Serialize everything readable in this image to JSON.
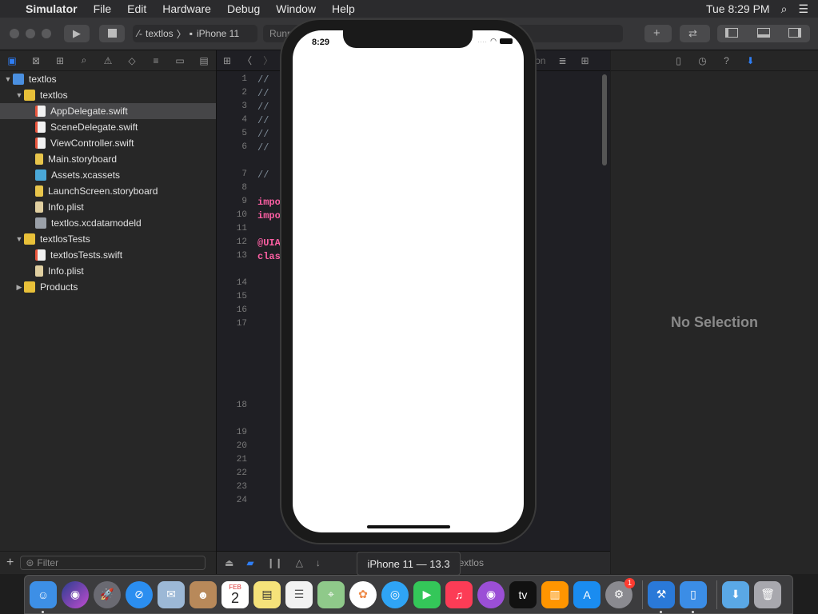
{
  "menubar": {
    "app": "Simulator",
    "menus": [
      "File",
      "Edit",
      "Hardware",
      "Debug",
      "Window",
      "Help"
    ],
    "clock": "Tue 8:29 PM"
  },
  "toolbar": {
    "scheme": "textlos",
    "device": "iPhone 11",
    "status": "Running"
  },
  "navigator": {
    "filter_placeholder": "Filter",
    "tree": [
      {
        "label": "textlos",
        "icon": "project-icon",
        "depth": 0,
        "disclosure": "open"
      },
      {
        "label": "textlos",
        "icon": "folder-icon",
        "depth": 1,
        "disclosure": "open"
      },
      {
        "label": "AppDelegate.swift",
        "icon": "swift-file-icon",
        "depth": 2,
        "selected": true
      },
      {
        "label": "SceneDelegate.swift",
        "icon": "swift-file-icon",
        "depth": 2
      },
      {
        "label": "ViewController.swift",
        "icon": "swift-file-icon",
        "depth": 2
      },
      {
        "label": "Main.storyboard",
        "icon": "storyboard-icon",
        "depth": 2
      },
      {
        "label": "Assets.xcassets",
        "icon": "assets-icon",
        "depth": 2
      },
      {
        "label": "LaunchScreen.storyboard",
        "icon": "storyboard-icon",
        "depth": 2
      },
      {
        "label": "Info.plist",
        "icon": "plist-icon",
        "depth": 2
      },
      {
        "label": "textlos.xcdatamodeld",
        "icon": "datamodel-icon",
        "depth": 2
      },
      {
        "label": "textlosTests",
        "icon": "folder-icon",
        "depth": 1,
        "disclosure": "open"
      },
      {
        "label": "textlosTests.swift",
        "icon": "swift-file-icon",
        "depth": 2
      },
      {
        "label": "Info.plist",
        "icon": "plist-icon",
        "depth": 2
      },
      {
        "label": "Products",
        "icon": "folder-icon",
        "depth": 1,
        "disclosure": "closed"
      }
    ]
  },
  "editor": {
    "jump_tail": "on",
    "lines": [
      {
        "n": "1",
        "text": "//"
      },
      {
        "n": "2",
        "text": "//"
      },
      {
        "n": "3",
        "text": "//"
      },
      {
        "n": "4",
        "text": "//"
      },
      {
        "n": "5",
        "text": "//"
      },
      {
        "n": "6",
        "text": "//"
      },
      {
        "n": "7",
        "text": "//"
      },
      {
        "n": "8",
        "text": ""
      },
      {
        "n": "9",
        "text": "impo",
        "kw": true
      },
      {
        "n": "10",
        "text": "impo",
        "kw": true
      },
      {
        "n": "11",
        "text": ""
      },
      {
        "n": "12",
        "text": "@UIA",
        "kw": true
      },
      {
        "n": "13",
        "text": "clas",
        "kw": true
      },
      {
        "n": "14",
        "text": ""
      },
      {
        "n": "15",
        "text": ""
      },
      {
        "n": "16",
        "text": ""
      },
      {
        "n": "17",
        "text": ""
      },
      {
        "n": "18",
        "text": ""
      },
      {
        "n": "19",
        "text": ""
      },
      {
        "n": "20",
        "text": ""
      },
      {
        "n": "21",
        "text": ""
      },
      {
        "n": "22",
        "text": ""
      },
      {
        "n": "23",
        "text": ""
      },
      {
        "n": "24",
        "text": ""
      }
    ],
    "debug_target": "textlos"
  },
  "inspector": {
    "empty_label": "No Selection"
  },
  "simulator": {
    "time": "8:29",
    "tooltip": "iPhone 11 — 13.3"
  },
  "dock": {
    "calendar_month": "FEB",
    "calendar_day": "2",
    "tv_label": "tv",
    "badge_count": "1"
  }
}
